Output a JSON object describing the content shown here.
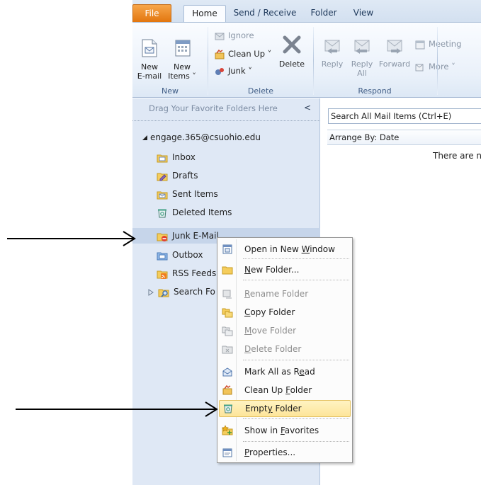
{
  "tabs": [
    "File",
    "Home",
    "Send / Receive",
    "Folder",
    "View"
  ],
  "ribbon": {
    "new_group": {
      "label": "New",
      "new_email": [
        "New",
        "E-mail"
      ],
      "new_items": [
        "New",
        "Items ˅"
      ]
    },
    "delete_group": {
      "label": "Delete",
      "ignore": "Ignore",
      "clean_up": "Clean Up ˅",
      "junk": "Junk ˅",
      "delete": "Delete"
    },
    "respond_group": {
      "label": "Respond",
      "reply": "Reply",
      "reply_all": [
        "Reply",
        "All"
      ],
      "forward": "Forward",
      "meeting": "Meeting",
      "more": "More ˅"
    }
  },
  "nav": {
    "favorites_hint": "Drag Your Favorite Folders Here",
    "collapse_glyph": "<",
    "account": "engage.365@csuohio.edu",
    "folders": {
      "inbox": "Inbox",
      "drafts": "Drafts",
      "sent": "Sent Items",
      "deleted": "Deleted Items",
      "junk": "Junk E-Mail",
      "outbox": "Outbox",
      "rss": "RSS Feeds",
      "search": "Search Fo"
    }
  },
  "mail": {
    "search_placeholder": "Search All Mail Items (Ctrl+E)",
    "arrange_by": "Arrange By: Date",
    "empty_message": "There are no"
  },
  "context_menu": {
    "open_window": {
      "pre": "Open in New ",
      "u": "W",
      "post": "indow"
    },
    "new_folder": {
      "pre": "",
      "u": "N",
      "post": "ew Folder..."
    },
    "rename": {
      "pre": "",
      "u": "R",
      "post": "ename Folder"
    },
    "copy": {
      "pre": "",
      "u": "C",
      "post": "opy Folder"
    },
    "move": {
      "pre": "",
      "u": "M",
      "post": "ove Folder"
    },
    "delete": {
      "pre": "",
      "u": "D",
      "post": "elete Folder"
    },
    "mark_read": {
      "pre": "Mark All as R",
      "u": "e",
      "post": "ad"
    },
    "cleanup": {
      "pre": "Clean Up ",
      "u": "F",
      "post": "older"
    },
    "empty": {
      "pre": "Empt",
      "u": "y",
      "post": " Folder"
    },
    "favorites": {
      "pre": "Show in ",
      "u": "F",
      "post": "avorites"
    },
    "properties": {
      "pre": "",
      "u": "P",
      "post": "roperties..."
    }
  },
  "colors": {
    "file_tab": "#e2760f",
    "ribbon_bg": "#eaf1fa",
    "nav_bg": "#dfe8f5",
    "junk_highlight": "#c6d5ea",
    "menu_hover": "#fde59a"
  }
}
